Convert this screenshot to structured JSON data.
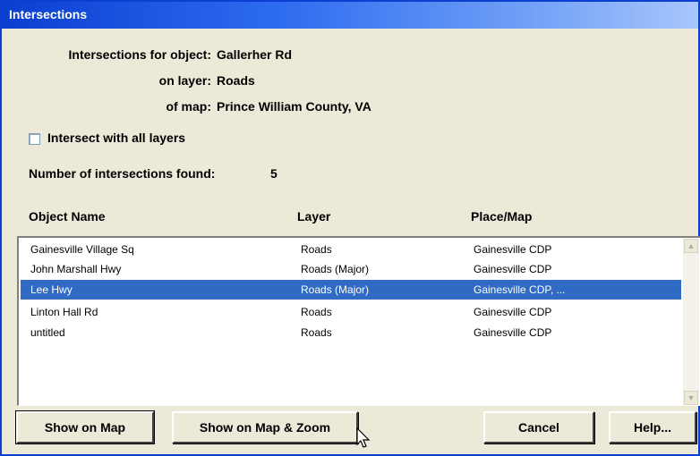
{
  "window": {
    "title": "Intersections"
  },
  "info": {
    "object_label": "Intersections for object:",
    "object_value": "Gallerher Rd",
    "layer_label": "on layer:",
    "layer_value": "Roads",
    "map_label": "of map:",
    "map_value": "Prince William County, VA"
  },
  "options": {
    "intersect_all_label": "Intersect with all layers",
    "intersect_all_checked": false
  },
  "summary": {
    "count_label": "Number of intersections found:",
    "count_value": "5"
  },
  "table": {
    "headers": [
      "Object Name",
      "Layer",
      "Place/Map"
    ],
    "rows": [
      {
        "name": "Gainesville Village Sq",
        "layer": "Roads",
        "place": "Gainesville CDP"
      },
      {
        "name": "John Marshall Hwy",
        "layer": "Roads (Major)",
        "place": "Gainesville CDP"
      },
      {
        "name": "Lee Hwy",
        "layer": "Roads (Major)",
        "place": "Gainesville CDP, ..."
      },
      {
        "name": "Linton Hall Rd",
        "layer": "Roads",
        "place": "Gainesville CDP"
      },
      {
        "name": "untitled",
        "layer": "Roads",
        "place": "Gainesville CDP"
      }
    ],
    "selected_index": 2
  },
  "buttons": {
    "show_on_map": "Show on Map",
    "show_on_map_zoom": "Show on Map & Zoom",
    "cancel": "Cancel",
    "help": "Help..."
  },
  "colors": {
    "titlebar": "#0a3fd0",
    "selection": "#316ac5",
    "dialog_bg": "#ece9d8"
  },
  "icons": {
    "scroll_up": "scroll-up-arrow-icon",
    "scroll_down": "scroll-down-arrow-icon",
    "cursor": "mouse-pointer-icon"
  }
}
